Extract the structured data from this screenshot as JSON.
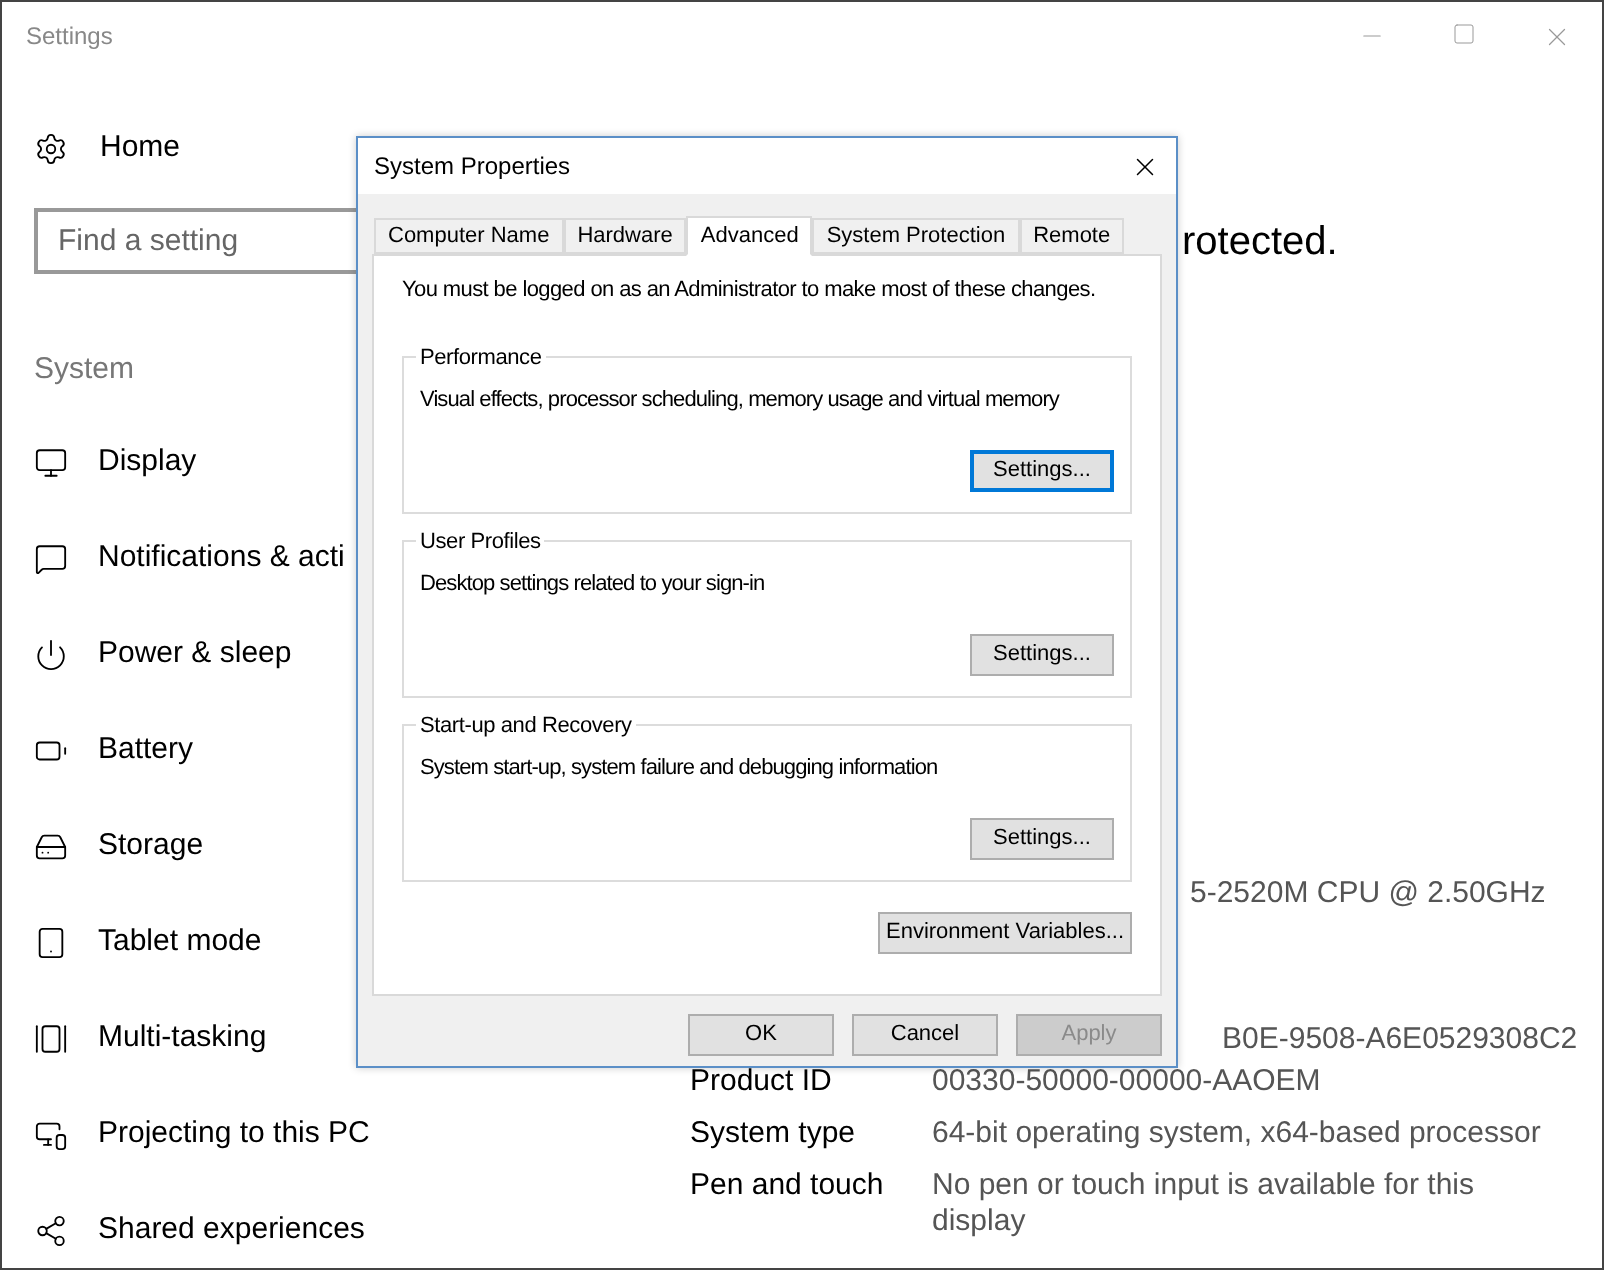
{
  "window": {
    "title": "Settings"
  },
  "sidebar": {
    "home": "Home",
    "search": {
      "placeholder": "Find a setting"
    },
    "section": "System",
    "items": [
      {
        "label": "Display"
      },
      {
        "label": "Notifications & acti"
      },
      {
        "label": "Power & sleep"
      },
      {
        "label": "Battery"
      },
      {
        "label": "Storage"
      },
      {
        "label": "Tablet mode"
      },
      {
        "label": "Multi-tasking"
      },
      {
        "label": "Projecting to this PC"
      },
      {
        "label": "Shared experiences"
      }
    ]
  },
  "content": {
    "heading_fragment": "rotected.",
    "specs_fragments": [
      "5-2520M CPU @ 2.50GHz",
      "B0E-9508-A6E0529308C2"
    ],
    "specs": [
      {
        "label": "Product ID",
        "value": "00330-50000-00000-AAOEM"
      },
      {
        "label": "System type",
        "value": "64-bit operating system, x64-based processor"
      },
      {
        "label": "Pen and touch",
        "value": "No pen or touch input is available for this display"
      }
    ]
  },
  "dialog": {
    "title": "System Properties",
    "tabs": [
      {
        "label": "Computer Name",
        "selected": false
      },
      {
        "label": "Hardware",
        "selected": false
      },
      {
        "label": "Advanced",
        "selected": true
      },
      {
        "label": "System Protection",
        "selected": false
      },
      {
        "label": "Remote",
        "selected": false
      }
    ],
    "notice": "You must be logged on as an Administrator to make most of these changes.",
    "groups": [
      {
        "title": "Performance",
        "description": "Visual effects, processor scheduling, memory usage and virtual memory",
        "button": "Settings...",
        "focused": true
      },
      {
        "title": "User Profiles",
        "description": "Desktop settings related to your sign-in",
        "button": "Settings...",
        "focused": false
      },
      {
        "title": "Start-up and Recovery",
        "description": "System start-up, system failure and debugging information",
        "button": "Settings...",
        "focused": false
      }
    ],
    "env_button": "Environment Variables...",
    "buttons": [
      {
        "label": "OK",
        "disabled": false
      },
      {
        "label": "Cancel",
        "disabled": false
      },
      {
        "label": "Apply",
        "disabled": true
      }
    ]
  }
}
